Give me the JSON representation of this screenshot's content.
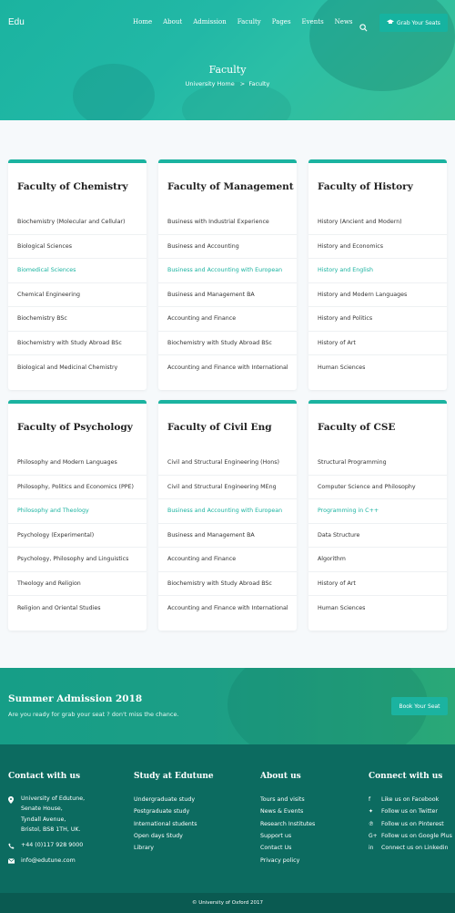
{
  "header": {
    "logo": "Edu",
    "menu": [
      "Home",
      "About",
      "Admission",
      "Faculty",
      "Pages",
      "Events",
      "News"
    ],
    "cta": "Grab Your Seats",
    "cta_icon": "graduation-cap-icon",
    "search_icon": "search-icon"
  },
  "hero": {
    "title": "Faculty",
    "breadcrumb_home": "University Home",
    "breadcrumb_sep": ">",
    "breadcrumb_current": "Faculty"
  },
  "accent": "#1bb3a0",
  "faculties": [
    {
      "title": "Faculty of Chemistry",
      "items": [
        "Biochemistry (Molecular and Cellular)",
        "Biological Sciences",
        "Biomedical Sciences",
        "Chemical Engineering",
        "Biochemistry BSc",
        "Biochemistry with Study Abroad BSc",
        "Biological and Medicinal Chemistry"
      ],
      "highlight": 2
    },
    {
      "title": "Faculty of Management",
      "items": [
        "Business with Industrial Experience",
        "Business and Accounting",
        "Business and Accounting with European",
        "Business and Management BA",
        "Accounting and Finance",
        "Biochemistry with Study Abroad BSc",
        "Accounting and Finance with International"
      ],
      "highlight": 2
    },
    {
      "title": "Faculty of History",
      "items": [
        "History (Ancient and Modern)",
        "History and Economics",
        "History and English",
        "History and Modern Languages",
        "History and Politics",
        "History of Art",
        "Human Sciences"
      ],
      "highlight": 2
    },
    {
      "title": "Faculty of Psychology",
      "items": [
        "Philosophy and Modern Languages",
        "Philosophy, Politics and Economics (PPE)",
        "Philosophy and Theology",
        "Psychology (Experimental)",
        "Psychology, Philosophy and Linguistics",
        "Theology and Religion",
        "Religion and Oriental Studies"
      ],
      "highlight": 2
    },
    {
      "title": "Faculty of Civil Eng",
      "items": [
        "Civil and Structural Engineering  (Hons)",
        "Civil and Structural Engineering MEng",
        "Business and Accounting with European",
        "Business and Management BA",
        "Accounting and Finance",
        "Biochemistry with Study Abroad BSc",
        "Accounting and Finance with International"
      ],
      "highlight": 2
    },
    {
      "title": "Faculty of CSE",
      "items": [
        "Structural Programming",
        "Computer Science and Philosophy",
        "Programming in C++",
        "Data Structure",
        "Algorithm",
        "History of Art",
        "Human Sciences"
      ],
      "highlight": 2
    }
  ],
  "banner": {
    "title": "Summer Admission 2018",
    "text": "Are you ready for grab your seat ? don't miss the chance.",
    "button": "Book Your Seat"
  },
  "footer": {
    "contact": {
      "title": "Contact with us",
      "address": [
        "University of Edutune,",
        "Senate House,",
        "Tyndall Avenue,",
        "Bristol, BS8 1TH, UK."
      ],
      "phone": "+44 (0)117 928 9000",
      "email": "info@edutune.com"
    },
    "study": {
      "title": "Study at Edutune",
      "links": [
        "Undergraduate study",
        "Postgraduate study",
        "International students",
        "Open days Study",
        "Library"
      ]
    },
    "about": {
      "title": "About us",
      "links": [
        "Tours and visits",
        "News & Events",
        "Research Institutes",
        "Support us",
        "Contact Us",
        "Privacy policy"
      ]
    },
    "connect": {
      "title": "Connect with us",
      "links": [
        {
          "icon": "facebook-icon",
          "label": "Like us on Facebook"
        },
        {
          "icon": "twitter-icon",
          "label": "Follow us on Twitter"
        },
        {
          "icon": "pinterest-icon",
          "label": "Follow us on Pinterest"
        },
        {
          "icon": "google-plus-icon",
          "label": "Follow us on Google Plus"
        },
        {
          "icon": "linkedin-icon",
          "label": "Connect us on Linkedin"
        }
      ]
    },
    "copyright": "© University of Oxford 2017"
  }
}
